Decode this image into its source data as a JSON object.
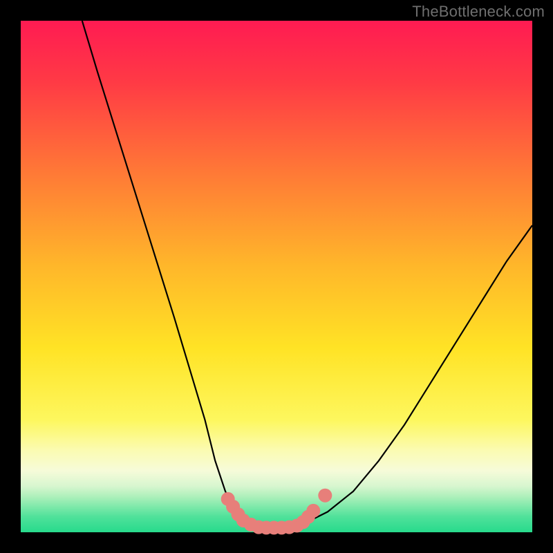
{
  "watermark": {
    "text": "TheBottleneck.com"
  },
  "colors": {
    "black": "#000000",
    "curve": "#000000",
    "marker_fill": "#e77f7a",
    "watermark": "#6f6f6f",
    "gradient_stops": [
      {
        "pct": 0,
        "color": "#ff1b52"
      },
      {
        "pct": 12,
        "color": "#ff3a45"
      },
      {
        "pct": 30,
        "color": "#ff7a36"
      },
      {
        "pct": 48,
        "color": "#ffb72a"
      },
      {
        "pct": 64,
        "color": "#ffe325"
      },
      {
        "pct": 78,
        "color": "#fdf75e"
      },
      {
        "pct": 84,
        "color": "#fbfbb2"
      },
      {
        "pct": 88,
        "color": "#f6fbd9"
      },
      {
        "pct": 91,
        "color": "#d7f6cf"
      },
      {
        "pct": 93,
        "color": "#aef0bb"
      },
      {
        "pct": 95,
        "color": "#7ee9aa"
      },
      {
        "pct": 97,
        "color": "#4fe19a"
      },
      {
        "pct": 100,
        "color": "#27da8c"
      }
    ]
  },
  "chart_data": {
    "type": "line",
    "title": "",
    "xlabel": "",
    "ylabel": "",
    "xlim": [
      0,
      100
    ],
    "ylim": [
      0,
      100
    ],
    "series": [
      {
        "name": "bottleneck-curve",
        "x": [
          12,
          15,
          20,
          25,
          30,
          33,
          36,
          38,
          40,
          42,
          44,
          47,
          50,
          53,
          56,
          60,
          65,
          70,
          75,
          80,
          85,
          90,
          95,
          100
        ],
        "values": [
          100,
          90,
          74,
          58,
          42,
          32,
          22,
          14,
          8,
          4,
          2,
          1,
          1,
          1,
          2,
          4,
          8,
          14,
          21,
          29,
          37,
          45,
          53,
          60
        ]
      }
    ],
    "markers": [
      {
        "x": 40.5,
        "y": 6.5
      },
      {
        "x": 41.5,
        "y": 5.0
      },
      {
        "x": 42.5,
        "y": 3.5
      },
      {
        "x": 43.5,
        "y": 2.3
      },
      {
        "x": 45.0,
        "y": 1.5
      },
      {
        "x": 46.5,
        "y": 1.0
      },
      {
        "x": 48.0,
        "y": 0.9
      },
      {
        "x": 49.5,
        "y": 0.9
      },
      {
        "x": 51.0,
        "y": 0.9
      },
      {
        "x": 52.5,
        "y": 1.0
      },
      {
        "x": 54.0,
        "y": 1.3
      },
      {
        "x": 55.2,
        "y": 2.0
      },
      {
        "x": 56.2,
        "y": 3.0
      },
      {
        "x": 57.2,
        "y": 4.2
      },
      {
        "x": 59.5,
        "y": 7.2
      }
    ]
  }
}
